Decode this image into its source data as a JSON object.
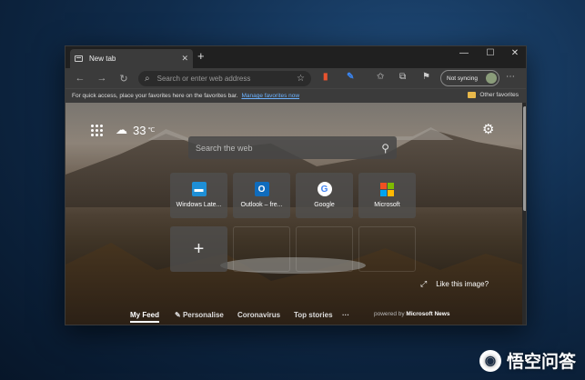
{
  "tab": {
    "title": "New tab",
    "close": "✕",
    "new": "+"
  },
  "window_controls": {
    "minimize": "—",
    "maximize": "☐",
    "close": "✕"
  },
  "toolbar": {
    "back": "←",
    "forward": "→",
    "refresh": "↻",
    "address_placeholder": "Search or enter web address",
    "sync_label": "Not syncing",
    "more": "⋯"
  },
  "favorites_bar": {
    "message": "For quick access, place your favorites here on the favorites bar.",
    "manage_link": "Manage favorites now",
    "other": "Other favorites"
  },
  "weather": {
    "temp": "33",
    "unit": "℃"
  },
  "search": {
    "placeholder": "Search the web"
  },
  "tiles": [
    {
      "label": "Windows Late...",
      "color": "#1e8fd6"
    },
    {
      "label": "Outlook – fre...",
      "color": "#0f6cbd"
    },
    {
      "label": "Google",
      "color": "#ffffff"
    },
    {
      "label": "Microsoft",
      "color": "#f25022"
    }
  ],
  "add_tile": "+",
  "like_image": "Like this image?",
  "feed": {
    "my_feed": "My Feed",
    "personalise": "Personalise",
    "coronavirus": "Coronavirus",
    "top_stories": "Top stories",
    "more": "···",
    "powered_prefix": "powered by",
    "powered_brand": "Microsoft News"
  },
  "watermark": {
    "text": "悟空问答"
  },
  "icons": [
    "tab-page-icon",
    "back-icon",
    "forward-icon",
    "refresh-icon",
    "search-icon",
    "favorite-star-icon",
    "office-extension-icon",
    "pen-extension-icon",
    "favorites-icon",
    "collections-icon",
    "share-icon",
    "apps-grid-icon",
    "weather-cloud-icon",
    "settings-gear-icon",
    "expand-icon",
    "folder-icon"
  ]
}
